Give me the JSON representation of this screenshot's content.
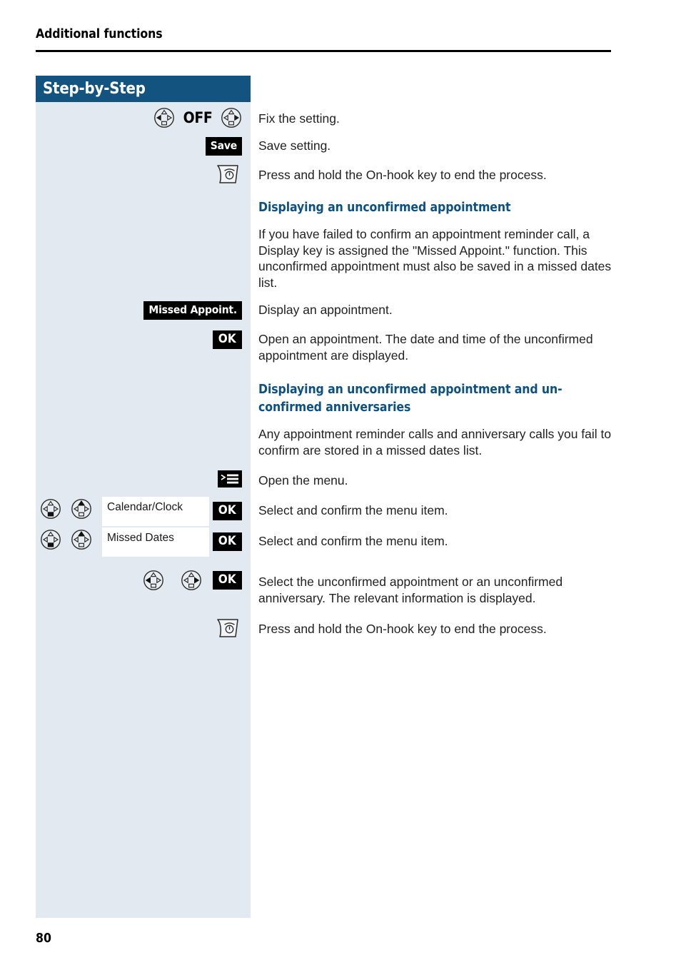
{
  "page": {
    "running_head": "Additional functions",
    "page_number": "80",
    "accent_color": "#0d5183",
    "panel_header_color": "#12547f",
    "panel_bg_color": "#e3e9f0",
    "badge_color": "#000000"
  },
  "sidebar": {
    "title": "Step-by-Step"
  },
  "steps": [
    {
      "id": "fix-setting",
      "left_kind": "navkeys_with_label",
      "nav_left": "navigation-key-left-icon",
      "label": "OFF",
      "nav_right": "navigation-key-right-icon",
      "text": "Fix the setting."
    },
    {
      "id": "save-setting",
      "left_kind": "badge",
      "badge": "Save",
      "text": "Save setting."
    },
    {
      "id": "end-process-1",
      "left_kind": "hookkey",
      "icon": "on-hook-key-icon",
      "text": "Press and hold the On-hook key to end the process."
    },
    {
      "id": "missed-appoint",
      "left_kind": "badge",
      "badge": "Missed Appoint.",
      "text": "Display an appointment."
    },
    {
      "id": "open-appointment",
      "left_kind": "badge",
      "badge": "OK",
      "text": "Open an appointment. The date and time of the unconfirmed appointment are displayed."
    },
    {
      "id": "open-menu",
      "left_kind": "menuicon",
      "icon": "menu-icon",
      "text": "Open the menu."
    },
    {
      "id": "calendar-clock",
      "left_kind": "menu_row",
      "nav_a": "navigation-key-down-icon",
      "nav_b": "navigation-key-up-icon",
      "menu_label": "Calendar/Clock",
      "badge": "OK",
      "text": "Select and confirm the menu item."
    },
    {
      "id": "missed-dates",
      "left_kind": "menu_row",
      "nav_a": "navigation-key-down-icon",
      "nav_b": "navigation-key-up-icon",
      "menu_label": "Missed Dates",
      "badge": "OK",
      "text": "Select and confirm the menu item."
    },
    {
      "id": "select-unconfirmed",
      "left_kind": "navkeys_ok",
      "nav_left": "navigation-key-left-icon",
      "nav_right": "navigation-key-right-icon",
      "badge": "OK",
      "text": "Select the unconfirmed appointment or an unconfirmed anniversary. The relevant information is displayed."
    },
    {
      "id": "end-process-2",
      "left_kind": "hookkey",
      "icon": "on-hook-key-icon",
      "text": "Press and hold the On-hook key to end the process."
    }
  ],
  "sections": [
    {
      "id": "section-1",
      "heading": "Displaying an unconfirmed appointment",
      "body": "If you have failed to confirm an appointment reminder call, a Display key is assigned the \"Missed Appoint.\" function. This unconfirmed appointment must also be saved in a missed dates list."
    },
    {
      "id": "section-2",
      "heading": "Displaying an unconfirmed appointment and unconfirmed anniversaries",
      "heading_line_1": "Displaying an unconfirmed appointment and un-",
      "heading_line_2": "confirmed anniversaries",
      "body": "Any appointment reminder calls and anniversary calls you fail to confirm are stored in a missed dates list."
    }
  ]
}
